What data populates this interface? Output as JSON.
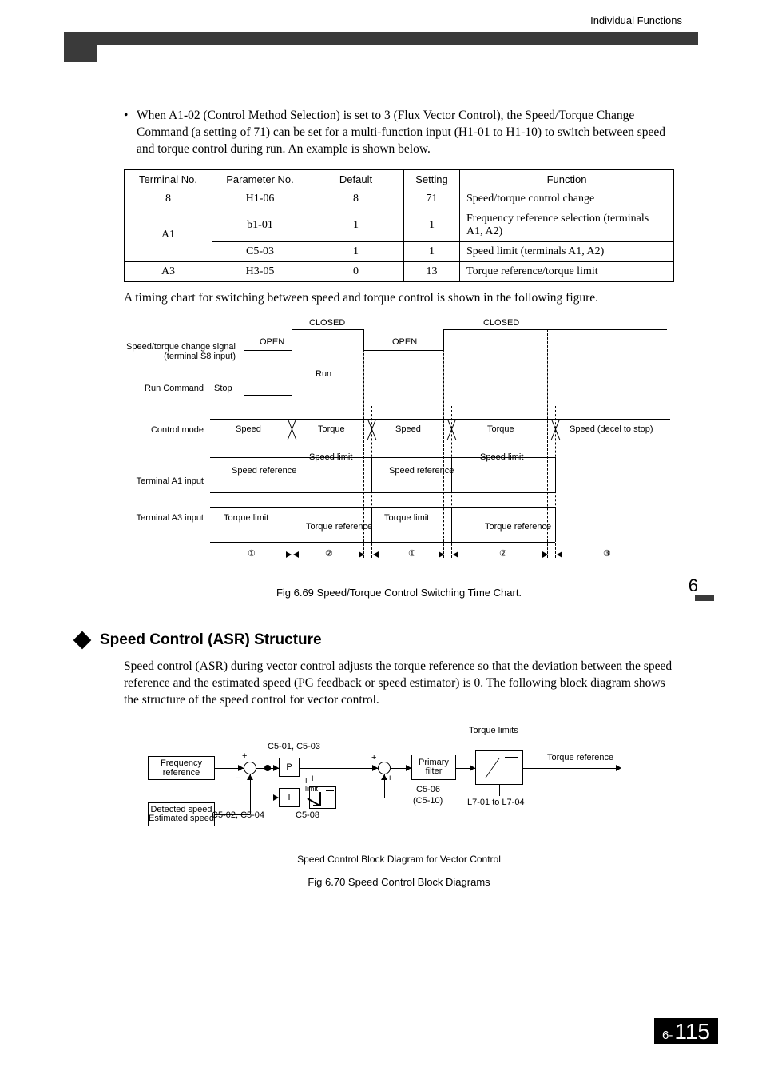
{
  "header": {
    "label": "Individual Functions"
  },
  "intro": {
    "bullet": "•",
    "text": "When A1-02 (Control Method Selection) is set to 3 (Flux Vector Control), the Speed/Torque Change Command (a setting of 71) can be set for a multi-function input (H1-01 to H1-10) to switch between speed and torque control during run. An example is shown below."
  },
  "table": {
    "headers": [
      "Terminal No.",
      "Parameter No.",
      "Default",
      "Setting",
      "Function"
    ],
    "rows": [
      {
        "terminal": "8",
        "param": "H1-06",
        "default": "8",
        "setting": "71",
        "function": "Speed/torque control change"
      },
      {
        "terminal": "A1",
        "param": "b1-01",
        "default": "1",
        "setting": "1",
        "function": "Frequency reference selection (terminals A1, A2)"
      },
      {
        "terminal": "A1",
        "param": "C5-03",
        "default": "1",
        "setting": "1",
        "function": "Speed limit (terminals A1, A2)"
      },
      {
        "terminal": "A3",
        "param": "H3-05",
        "default": "0",
        "setting": "13",
        "function": "Torque reference/torque limit"
      }
    ]
  },
  "after_table": "A timing chart for switching between speed and torque control is shown in the following figure.",
  "chart1": {
    "labels": {
      "sig1a": "Speed/torque change signal",
      "sig1b": "(terminal S8 input)",
      "run": "Run Command",
      "mode": "Control mode",
      "a1": "Terminal A1 input",
      "a3": "Terminal A3 input"
    },
    "states": {
      "open": "OPEN",
      "closed": "CLOSED",
      "run": "Run",
      "stop": "Stop",
      "speed": "Speed",
      "torque": "Torque",
      "decel": "Speed (decel to stop)",
      "speed_ref": "Speed reference",
      "speed_limit": "Speed limit",
      "torque_limit": "Torque limit",
      "torque_ref": "Torque reference"
    },
    "markers": {
      "m1": "①",
      "m2": "②",
      "m3": "③"
    },
    "caption": "Fig 6.69  Speed/Torque Control Switching Time Chart."
  },
  "section2": {
    "title": "Speed Control (ASR) Structure",
    "para": "Speed control (ASR) during vector control adjusts the torque reference so that the deviation between the speed reference and the estimated speed (PG feedback or speed estimator) is 0. The following block diagram shows the structure of the speed control for vector control."
  },
  "chart2": {
    "freq_ref": "Frequency reference",
    "det_speed": "Detected speed",
    "est_speed": "Estimated speed",
    "P": "P",
    "I": "I",
    "c5_01_03": "C5-01, C5-03",
    "c5_02_04": "C5-02, C5-04",
    "c5_08": "C5-08",
    "i_limit": "I limit",
    "primary": "Primary filter",
    "c5_06": "C5-06",
    "c5_10": "(C5-10)",
    "torque_limits": "Torque limits",
    "l7": "L7-01 to L7-04",
    "torque_ref": "Torque reference",
    "plus": "+",
    "minus": "−",
    "subcaption": "Speed Control Block Diagram for Vector Control",
    "caption": "Fig 6.70  Speed Control Block Diagrams"
  },
  "side": {
    "chapter": "6"
  },
  "footer": {
    "prefix": "6-",
    "page": "115"
  },
  "chart_data": [
    {
      "type": "table",
      "title": "Timing chart: Speed/Torque control switching",
      "signals": {
        "speed_torque_change_signal": [
          "OPEN",
          "CLOSED",
          "OPEN",
          "CLOSED",
          "CLOSED"
        ],
        "run_command": [
          "Stop",
          "Run",
          "Run",
          "Run",
          "Run"
        ],
        "control_mode": [
          "Speed",
          "Torque",
          "Speed",
          "Torque",
          "Speed (decel to stop)"
        ],
        "terminal_A1_input": [
          "Speed reference",
          "Speed limit",
          "Speed reference",
          "Speed limit",
          ""
        ],
        "terminal_A3_input": [
          "Torque limit",
          "Torque reference",
          "Torque limit",
          "Torque reference",
          ""
        ]
      },
      "region_markers": [
        "①",
        "②",
        "①",
        "②",
        "③"
      ]
    },
    {
      "type": "diagram",
      "title": "Speed Control Block Diagram for Vector Control",
      "flow": [
        "Frequency reference → (+) summing node",
        "Detected speed / Estimated speed → (−) summing node",
        "summing node → P (gain C5-01, C5-03) → (+) summing node 2",
        "summing node → I (gain C5-02, C5-04) with I-limit C5-08 → (+) summing node 2",
        "summing node 2 → Primary filter (C5-06, C5-10) → Torque limits (L7-01 to L7-04) → Torque reference"
      ]
    }
  ]
}
